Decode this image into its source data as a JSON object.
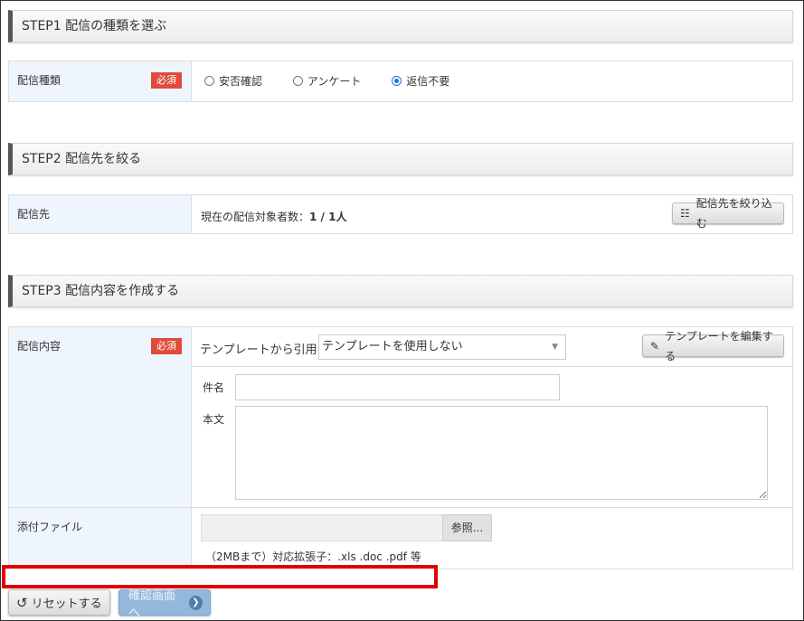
{
  "step1": {
    "title": "STEP1 配信の種類を選ぶ",
    "label": "配信種類",
    "required": "必須",
    "options": [
      {
        "label": "安否確認",
        "checked": false
      },
      {
        "label": "アンケート",
        "checked": false
      },
      {
        "label": "返信不要",
        "checked": true
      }
    ]
  },
  "step2": {
    "title": "STEP2 配信先を絞る",
    "label": "配信先",
    "count_label": "現在の配信対象者数：",
    "count_value": "1 / 1人",
    "filter_button": "配信先を絞り込む"
  },
  "step3": {
    "title": "STEP3 配信内容を作成する",
    "label": "配信内容",
    "required": "必須",
    "template_label": "テンプレートから引用：",
    "template_selected": "テンプレートを使用しない",
    "edit_template_button": "テンプレートを編集する",
    "subject_label": "件名",
    "subject_value": "",
    "body_label": "本文",
    "body_value": "",
    "attachment_label": "添付ファイル",
    "browse_button": "参照...",
    "attachment_note": "（2MBまで）対応拡張子：.xls .doc .pdf 等"
  },
  "buttons": {
    "reset": "リセットする",
    "confirm": "確認画面へ"
  },
  "colors": {
    "required_badge": "#e04b3b",
    "label_bg": "#eef5fc",
    "highlight_border": "#e00000",
    "confirm_button": "#93b8dc"
  }
}
